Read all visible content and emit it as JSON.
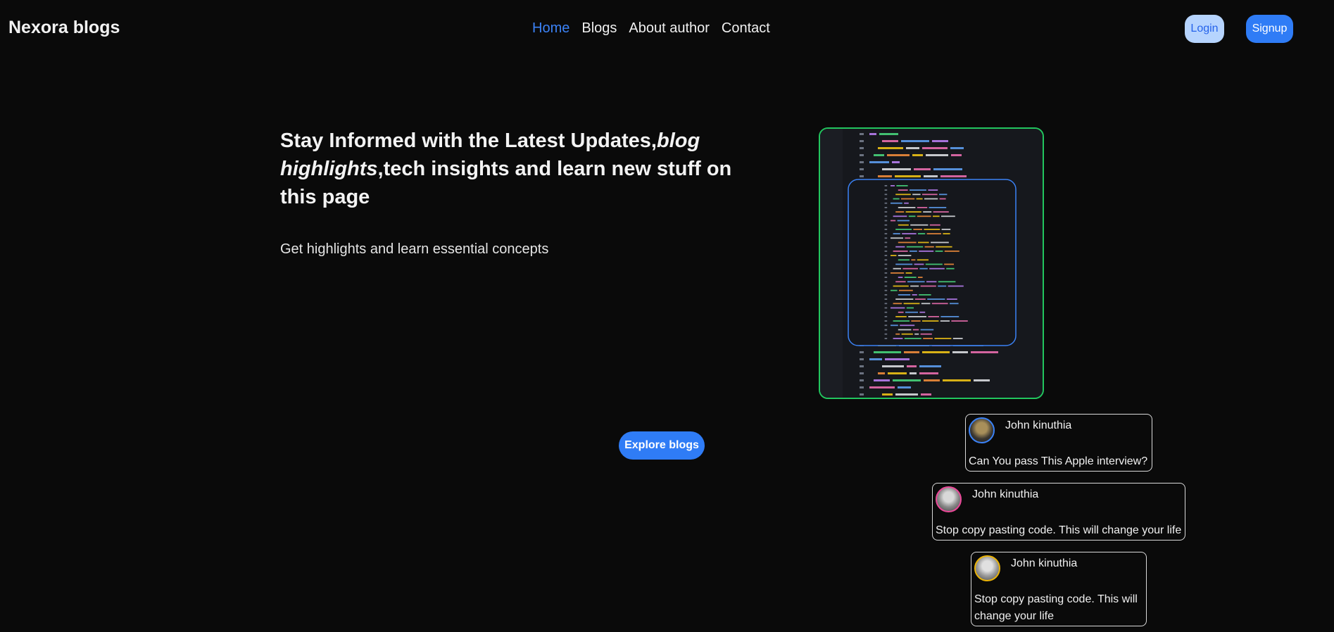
{
  "header": {
    "brand": "Nexora blogs",
    "nav": [
      {
        "label": "Home",
        "active": true
      },
      {
        "label": "Blogs",
        "active": false
      },
      {
        "label": "About author",
        "active": false
      },
      {
        "label": "Contact",
        "active": false
      }
    ],
    "login_label": "Login",
    "signup_label": "Signup"
  },
  "hero": {
    "title_part1": "Stay Informed with the Latest Updates,",
    "title_emphasis": "blog highlights",
    "title_part2": ",tech insights and learn new stuff on this page",
    "subtitle": "Get highlights and learn essential concepts",
    "explore_label": "Explore blogs",
    "image_icon": "code-editor-screenshot"
  },
  "cards": [
    {
      "author": "John kinuthia",
      "title": "Can You pass This Apple interview?",
      "avatar_border": "#3b82f6"
    },
    {
      "author": "John kinuthia",
      "title": "Stop copy pasting code. This will change your life",
      "avatar_border": "#ec4899"
    },
    {
      "author": "John kinuthia",
      "title": "Stop copy pasting code. This will change your life",
      "avatar_border": "#eab308"
    }
  ],
  "colors": {
    "background": "#0a0a0a",
    "accent": "#2f7cf6",
    "nav_active": "#3b82f6",
    "login_bg": "#b6d4fe",
    "image_border": "#22c55e"
  }
}
